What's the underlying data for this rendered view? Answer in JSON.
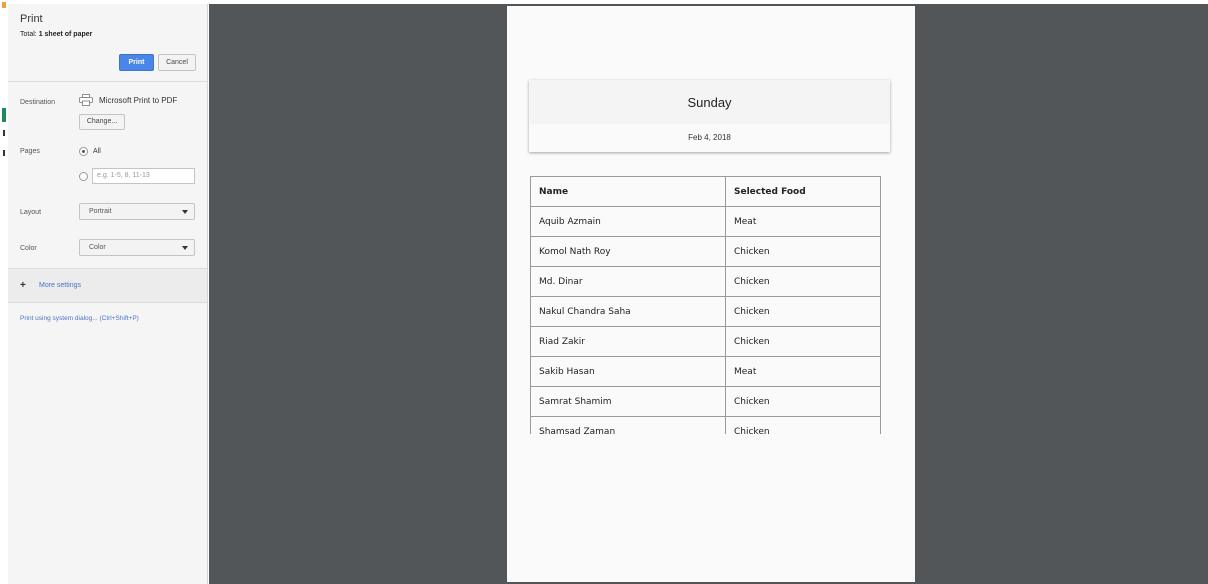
{
  "sidebar": {
    "title": "Print",
    "total_prefix": "Total: ",
    "total_value": "1 sheet of paper",
    "print_button": "Print",
    "cancel_button": "Cancel",
    "destination": {
      "label": "Destination",
      "value": "Microsoft Print to PDF",
      "change_button": "Change..."
    },
    "pages": {
      "label": "Pages",
      "option_all": "All",
      "range_placeholder": "e.g. 1-5, 8, 11-13"
    },
    "layout": {
      "label": "Layout",
      "value": "Portrait"
    },
    "color": {
      "label": "Color",
      "value": "Color"
    },
    "more_settings": "More settings",
    "system_dialog": "Print using system dialog... (Ctrl+Shift+P)"
  },
  "preview": {
    "day": "Sunday",
    "date": "Feb 4, 2018",
    "table": {
      "headers": [
        "Name",
        "Selected Food"
      ],
      "rows": [
        [
          "Aquib Azmain",
          "Meat"
        ],
        [
          "Komol Nath Roy",
          "Chicken"
        ],
        [
          "Md. Dinar",
          "Chicken"
        ],
        [
          "Nakul Chandra Saha",
          "Chicken"
        ],
        [
          "Riad Zakir",
          "Chicken"
        ],
        [
          "Sakib Hasan",
          "Meat"
        ],
        [
          "Samrat Shamim",
          "Chicken"
        ],
        [
          "Shamsad Zaman",
          "Chicken"
        ]
      ]
    }
  },
  "colors": {
    "print_button": "#4a86e8",
    "preview_background": "#525659",
    "link": "#4a73c9"
  },
  "icons": {
    "destination": "printer-icon",
    "more_settings": "plus-icon"
  }
}
